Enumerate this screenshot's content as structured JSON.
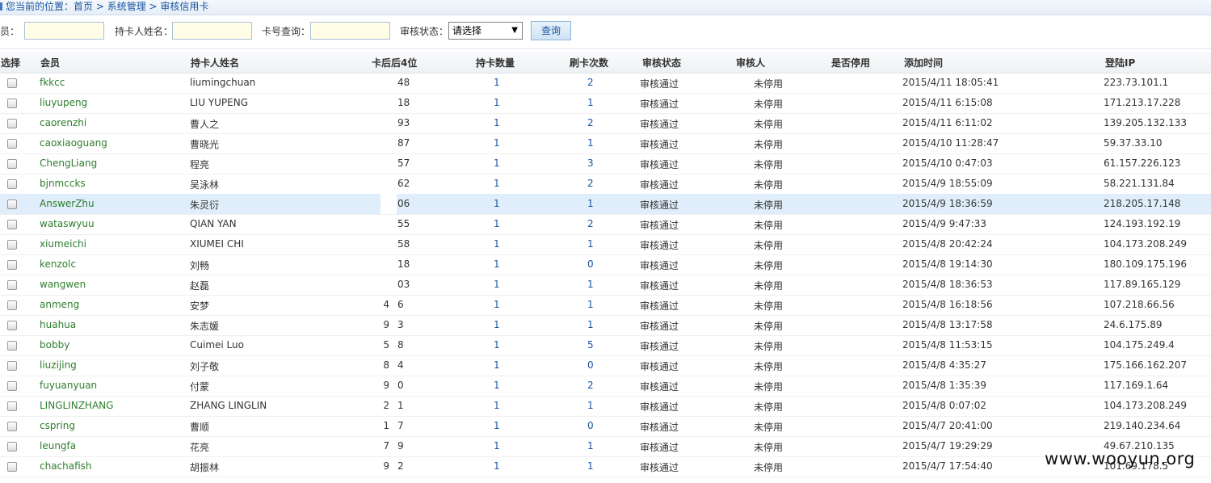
{
  "breadcrumb": {
    "prefix": "您当前的位置：",
    "items": [
      "首页",
      "系统管理",
      "审核信用卡"
    ],
    "sep": " > "
  },
  "filters": {
    "member_label": "员：",
    "member_value": "",
    "holder_label": "持卡人姓名：",
    "holder_value": "",
    "card_label": "卡号查询：",
    "card_value": "",
    "status_label": "审核状态：",
    "status_selected": "请选择",
    "query_button": "查询"
  },
  "table": {
    "headers": {
      "select": "选择",
      "member": "会员",
      "holder": "持卡人姓名",
      "last4": "卡后后4位",
      "cards": "持卡数量",
      "swipes": "刷卡次数",
      "status": "审核状态",
      "reviewer": "审核人",
      "stopped": "是否停用",
      "added": "添加时间",
      "ip": "登陆IP"
    },
    "rows": [
      {
        "member": "fkkcc",
        "holder": "liumingchuan",
        "pre": "",
        "last4": "48",
        "cards": "1",
        "swipes": "2",
        "status": "审核通过",
        "stopped": "未停用",
        "added": "2015/4/11 18:05:41",
        "ip": "223.73.101.1"
      },
      {
        "member": "liuyupeng",
        "holder": "LIU YUPENG",
        "pre": "",
        "last4": "18",
        "cards": "1",
        "swipes": "1",
        "status": "审核通过",
        "stopped": "未停用",
        "added": "2015/4/11 6:15:08",
        "ip": "171.213.17.228"
      },
      {
        "member": "caorenzhi",
        "holder": "曹人之",
        "pre": "",
        "last4": "93",
        "cards": "1",
        "swipes": "2",
        "status": "审核通过",
        "stopped": "未停用",
        "added": "2015/4/11 6:11:02",
        "ip": "139.205.132.133"
      },
      {
        "member": "caoxiaoguang",
        "holder": "曹晓光",
        "pre": "",
        "last4": "87",
        "cards": "1",
        "swipes": "1",
        "status": "审核通过",
        "stopped": "未停用",
        "added": "2015/4/10 11:28:47",
        "ip": "59.37.33.10"
      },
      {
        "member": "ChengLiang",
        "holder": "程亮",
        "pre": "",
        "last4": "57",
        "cards": "1",
        "swipes": "3",
        "status": "审核通过",
        "stopped": "未停用",
        "added": "2015/4/10 0:47:03",
        "ip": "61.157.226.123"
      },
      {
        "member": "bjnmccks",
        "holder": "吴泳林",
        "pre": "",
        "last4": "62",
        "cards": "1",
        "swipes": "2",
        "status": "审核通过",
        "stopped": "未停用",
        "added": "2015/4/9 18:55:09",
        "ip": "58.221.131.84"
      },
      {
        "member": "AnswerZhu",
        "holder": "朱灵衍",
        "pre": "",
        "last4": "06",
        "cards": "1",
        "swipes": "1",
        "status": "审核通过",
        "stopped": "未停用",
        "added": "2015/4/9 18:36:59",
        "ip": "218.205.17.148",
        "highlight": true
      },
      {
        "member": "wataswyuu",
        "holder": "QIAN YAN",
        "pre": "",
        "last4": "55",
        "cards": "1",
        "swipes": "2",
        "status": "审核通过",
        "stopped": "未停用",
        "added": "2015/4/9 9:47:33",
        "ip": "124.193.192.19"
      },
      {
        "member": "xiumeichi",
        "holder": "XIUMEI CHI",
        "pre": "",
        "last4": "58",
        "cards": "1",
        "swipes": "1",
        "status": "审核通过",
        "stopped": "未停用",
        "added": "2015/4/8 20:42:24",
        "ip": "104.173.208.249"
      },
      {
        "member": "kenzolc",
        "holder": "刘畅",
        "pre": "",
        "last4": "18",
        "cards": "1",
        "swipes": "0",
        "status": "审核通过",
        "stopped": "未停用",
        "added": "2015/4/8 19:14:30",
        "ip": "180.109.175.196"
      },
      {
        "member": "wangwen",
        "holder": "赵磊",
        "pre": "",
        "last4": "03",
        "cards": "1",
        "swipes": "1",
        "status": "审核通过",
        "stopped": "未停用",
        "added": "2015/4/8 18:36:53",
        "ip": "117.89.165.129"
      },
      {
        "member": "anmeng",
        "holder": "安梦",
        "pre": "4",
        "last4": "6",
        "cards": "1",
        "swipes": "1",
        "status": "审核通过",
        "stopped": "未停用",
        "added": "2015/4/8 16:18:56",
        "ip": "107.218.66.56"
      },
      {
        "member": "huahua",
        "holder": "朱志媛",
        "pre": "9",
        "last4": "3",
        "cards": "1",
        "swipes": "1",
        "status": "审核通过",
        "stopped": "未停用",
        "added": "2015/4/8 13:17:58",
        "ip": "24.6.175.89"
      },
      {
        "member": "bobby",
        "holder": "Cuimei Luo",
        "pre": "5",
        "last4": "8",
        "cards": "1",
        "swipes": "5",
        "status": "审核通过",
        "stopped": "未停用",
        "added": "2015/4/8 11:53:15",
        "ip": "104.175.249.4"
      },
      {
        "member": "liuzijing",
        "holder": "刘子敬",
        "pre": "8",
        "last4": "4",
        "cards": "1",
        "swipes": "0",
        "status": "审核通过",
        "stopped": "未停用",
        "added": "2015/4/8 4:35:27",
        "ip": "175.166.162.207"
      },
      {
        "member": "fuyuanyuan",
        "holder": "付蒙",
        "pre": "9",
        "last4": "0",
        "cards": "1",
        "swipes": "2",
        "status": "审核通过",
        "stopped": "未停用",
        "added": "2015/4/8 1:35:39",
        "ip": "117.169.1.64"
      },
      {
        "member": "LINGLINZHANG",
        "holder": "ZHANG LINGLIN",
        "pre": "2",
        "last4": "1",
        "cards": "1",
        "swipes": "1",
        "status": "审核通过",
        "stopped": "未停用",
        "added": "2015/4/8 0:07:02",
        "ip": "104.173.208.249"
      },
      {
        "member": "cspring",
        "holder": "曹顺",
        "pre": "1",
        "last4": "7",
        "cards": "1",
        "swipes": "0",
        "status": "审核通过",
        "stopped": "未停用",
        "added": "2015/4/7 20:41:00",
        "ip": "219.140.234.64"
      },
      {
        "member": "leungfa",
        "holder": "花亮",
        "pre": "7",
        "last4": "9",
        "cards": "1",
        "swipes": "1",
        "status": "审核通过",
        "stopped": "未停用",
        "added": "2015/4/7 19:29:29",
        "ip": "49.67.210.135"
      },
      {
        "member": "chachafish",
        "holder": "胡振林",
        "pre": "9",
        "last4": "2",
        "cards": "1",
        "swipes": "1",
        "status": "审核通过",
        "stopped": "未停用",
        "added": "2015/4/7 17:54:40",
        "ip": "101.69.178.5"
      }
    ]
  },
  "watermark": "www.wooyun.org"
}
